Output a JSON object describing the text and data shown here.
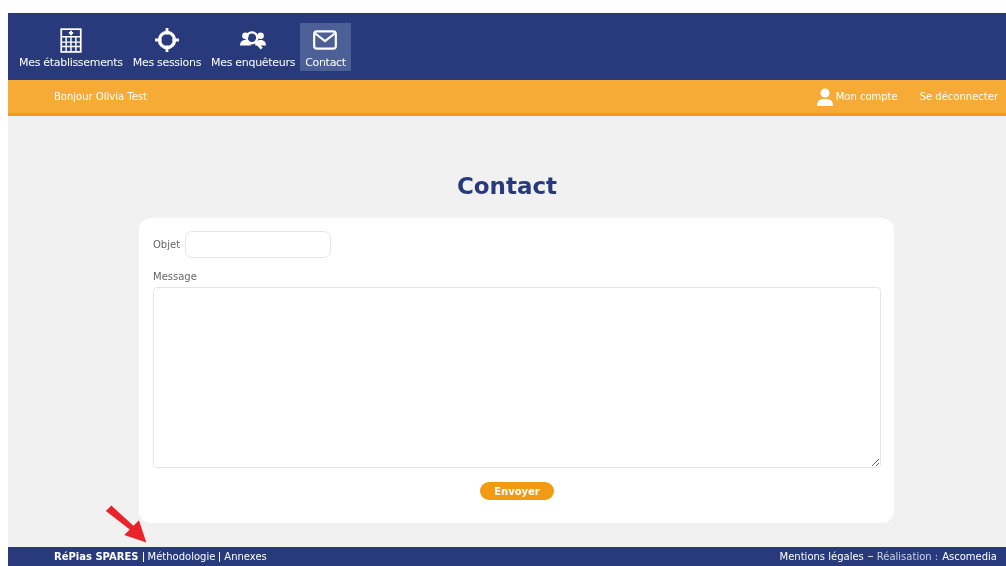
{
  "nav": {
    "items": [
      {
        "label": "Mes établissements",
        "kind": "building",
        "selected": false
      },
      {
        "label": "Mes sessions",
        "kind": "target",
        "selected": false
      },
      {
        "label": "Mes enquêteurs",
        "kind": "people",
        "selected": false
      },
      {
        "label": "Contact",
        "kind": "mail",
        "selected": true
      }
    ]
  },
  "user_bar": {
    "greeting": "Bonjour Olivia Test",
    "account": "Mon compte",
    "logout": "Se déconnecter"
  },
  "title": "Contact",
  "form": {
    "subject_label": "Objet",
    "message_label": "Message",
    "submit": "Envoyer"
  },
  "footer": {
    "brand": "RéPias SPARES",
    "left_links": [
      "Méthodologie",
      "Annexes"
    ],
    "legal": "Mentions légales",
    "credit_label": "Réalisation :",
    "credit": "Ascomedia"
  }
}
